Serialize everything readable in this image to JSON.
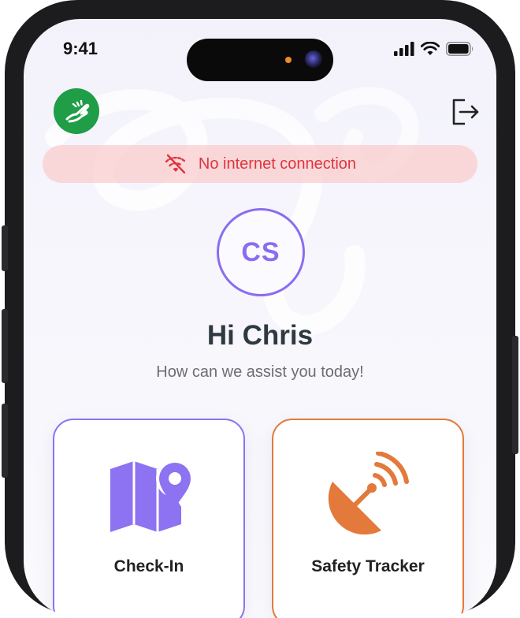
{
  "status_bar": {
    "time": "9:41"
  },
  "header": {
    "logo_icon": "hand-pointer-icon",
    "logout_icon": "logout-icon"
  },
  "banner": {
    "icon": "wifi-off-icon",
    "text": "No internet connection"
  },
  "profile": {
    "initials": "CS",
    "greeting": "Hi Chris",
    "subtitle": "How can we assist you today!"
  },
  "cards": [
    {
      "label": "Check-In",
      "icon": "map-pin-icon"
    },
    {
      "label": "Safety Tracker",
      "icon": "satellite-dish-icon"
    }
  ],
  "colors": {
    "accent_purple": "#8a6df0",
    "accent_orange": "#e3793a",
    "brand_green": "#1f9d47",
    "error_red": "#e0343d",
    "banner_bg": "#facdcd"
  }
}
